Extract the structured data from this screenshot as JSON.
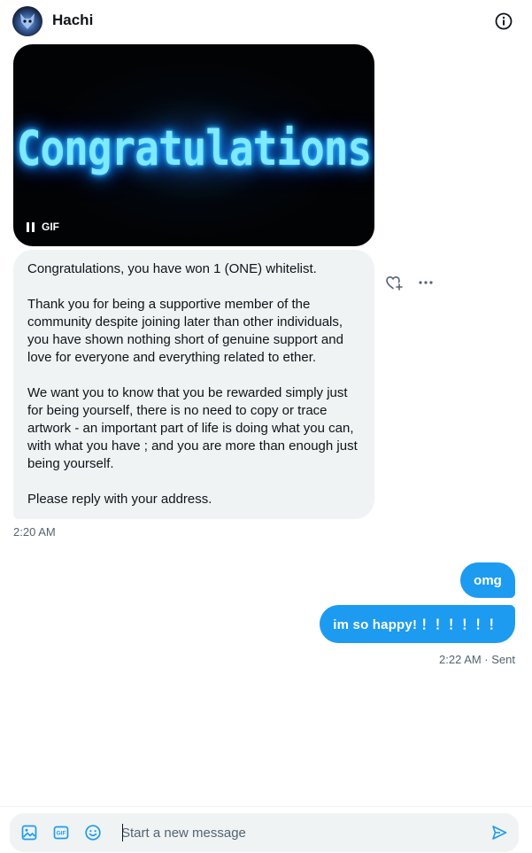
{
  "header": {
    "contact_name": "Hachi",
    "avatar_icon": "avatar-image",
    "info_icon": "info-circle-icon"
  },
  "gif": {
    "text": "Congratulations",
    "badge": "GIF",
    "control_icon": "pause-icon"
  },
  "incoming_message": {
    "paragraphs": [
      "Congratulations, you have won 1 (ONE) whitelist.",
      "Thank you for being a supportive member of the community despite joining later than other individuals, you have shown nothing short of genuine support and love for everyone and everything related to ether.",
      "We want you to know that you be rewarded simply just for being yourself, there is no need to copy or trace artwork - an important part of life is doing what you can, with what you have ; and you are more than enough just being yourself.",
      "Please reply with your address."
    ],
    "timestamp": "2:20 AM",
    "react_icon": "heart-plus-icon",
    "more_icon": "more-horizontal-icon"
  },
  "outgoing_messages": [
    {
      "text": "omg"
    },
    {
      "text": "im so happy! ！！！！！！"
    }
  ],
  "outgoing_status": "2:22 AM · Sent",
  "composer": {
    "placeholder": "Start a new message",
    "value": "",
    "media_icon": "image-icon",
    "gif_icon": "gif-icon",
    "emoji_icon": "emoji-icon",
    "send_icon": "send-icon"
  },
  "colors": {
    "accent": "#1d9bf0",
    "bubble_incoming": "#eff3f4",
    "text_primary": "#0f1419",
    "text_secondary": "#536471",
    "gif_glow": "#7ee9ff"
  }
}
